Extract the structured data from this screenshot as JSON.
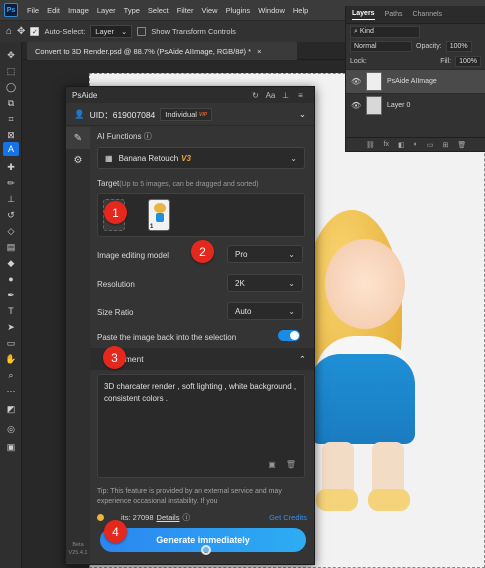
{
  "app": {
    "logo": "Ps",
    "menu": [
      "File",
      "Edit",
      "Image",
      "Layer",
      "Type",
      "Select",
      "Filter",
      "View",
      "Plugins",
      "Window",
      "Help"
    ]
  },
  "options_bar": {
    "home_icon": "home-icon",
    "move_icon": "move-icon",
    "auto_select_label": "Auto-Select:",
    "auto_select_value": "Layer",
    "transform_label": "Show Transform Controls"
  },
  "document_tab": {
    "title": "Convert to 3D Render.psd @ 88.7% (PsAide AIImage, RGB/8#) *",
    "close": "×"
  },
  "layers_panel": {
    "tabs": [
      "Layers",
      "Paths",
      "Channels"
    ],
    "filter_label": "Kind",
    "blend_mode": "Normal",
    "opacity_label": "Opacity:",
    "opacity_value": "100%",
    "lock_label": "Lock:",
    "fill_label": "Fill:",
    "fill_value": "100%",
    "layers": [
      {
        "name": "PsAide AIImage",
        "visible": true,
        "selected": true
      },
      {
        "name": "Layer 0",
        "visible": true,
        "selected": false
      }
    ],
    "footer_icons": [
      "link-icon",
      "fx-icon",
      "mask-icon",
      "adjustment-icon",
      "folder-icon",
      "new-layer-icon",
      "trash-icon"
    ]
  },
  "plugin": {
    "title": "PsAide",
    "uid_label": "UID：619007084",
    "plan": "Individual",
    "vip_badge": "VIP",
    "ai_functions_label": "AI Functions",
    "ai_function_value": "Banana Retouch",
    "ai_function_version": "V3",
    "target_label": "Target",
    "target_hint": "(Up to 5 images, can be dragged and sorted)",
    "target_slot_number": "1",
    "model_label": "Image editing model",
    "model_value": "Pro",
    "resolution_label": "Resolution",
    "resolution_value": "2K",
    "size_ratio_label": "Size Ratio",
    "size_ratio_value": "Auto",
    "paste_back_label": "Paste the image back into the selection",
    "paste_back_enabled": true,
    "requirement_label": "ement",
    "requirement_text": "3D charcater render , soft lighting , white background , consistent colors .",
    "tip_text": "Tip: This feature is provided by an external service and may experience occasional instability. If you",
    "credits_label": "its: 27098",
    "details_label": "Details",
    "get_credits_label": "Get Credits",
    "generate_label": "Generate immediately",
    "beta_label": "Beta",
    "version_label": "V25.4.1"
  },
  "markers": [
    "1",
    "2",
    "3",
    "4"
  ],
  "colors": {
    "accent": "#1a8ce8",
    "marker": "#e5281d",
    "vip": "#e85d2a",
    "v3": "#e8a53a",
    "link": "#3b8de8"
  }
}
